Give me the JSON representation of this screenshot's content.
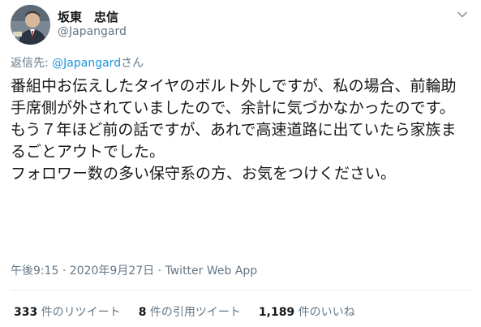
{
  "tweet": {
    "author_name": "坂東　忠信",
    "author_handle": "@Japangard",
    "reply_prefix": "返信先: ",
    "reply_mention": "@Japangard",
    "reply_suffix": "さん",
    "body_para1": "番組中お伝えしたタイヤのボルト外しですが、私の場合、前輪助手席側が外されていましたので、余計に気づかなかったのです。もう７年ほど前の話ですが、あれで高速道路に出ていたら家族まるごとアウトでした。",
    "body_para2": "フォロワー数の多い保守系の方、お気をつけください。",
    "timestamp": "午後9:15 · 2020年9月27日 · Twitter Web App"
  },
  "stats": {
    "retweets_count": "333",
    "retweets_label": "件のリツイート",
    "quotes_count": "8",
    "quotes_label": "件の引用ツイート",
    "likes_count": "1,189",
    "likes_label": "件のいいね"
  },
  "icons": {
    "menu": "chevron-down-icon",
    "avatar": "avatar"
  },
  "colors": {
    "link": "#1b95e0",
    "secondary_text": "#657786",
    "divider": "#e6ecf0"
  }
}
